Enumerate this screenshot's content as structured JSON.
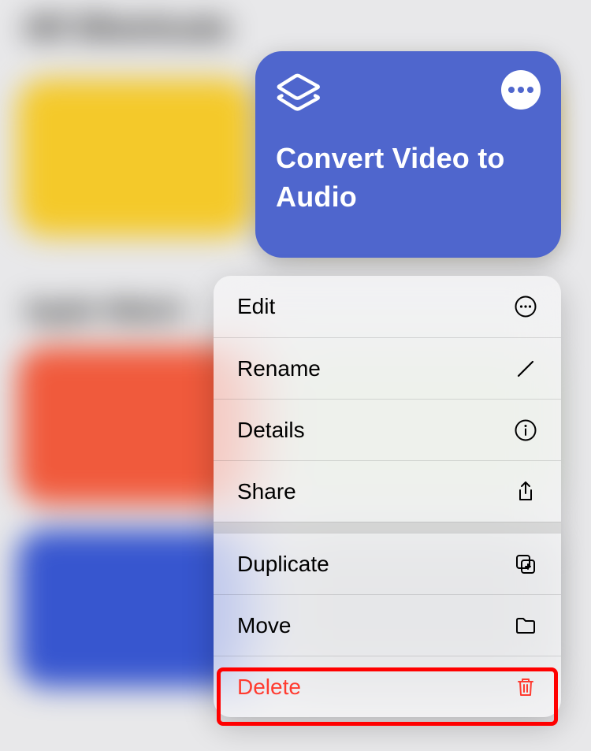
{
  "card": {
    "title": "Convert Video to Audio",
    "icon": "shortcuts-layers-icon",
    "bg": "#4f66cd"
  },
  "menu": {
    "groups": [
      [
        {
          "label": "Edit",
          "icon": "more-circle-icon"
        },
        {
          "label": "Rename",
          "icon": "pencil-icon"
        },
        {
          "label": "Details",
          "icon": "info-circle-icon"
        },
        {
          "label": "Share",
          "icon": "share-icon"
        }
      ],
      [
        {
          "label": "Duplicate",
          "icon": "duplicate-icon"
        },
        {
          "label": "Move",
          "icon": "folder-icon"
        },
        {
          "label": "Delete",
          "icon": "trash-icon",
          "destructive": true,
          "highlighted": true
        }
      ]
    ]
  },
  "background": {
    "heading": "All Shortcuts",
    "section": "Apple Watch"
  }
}
